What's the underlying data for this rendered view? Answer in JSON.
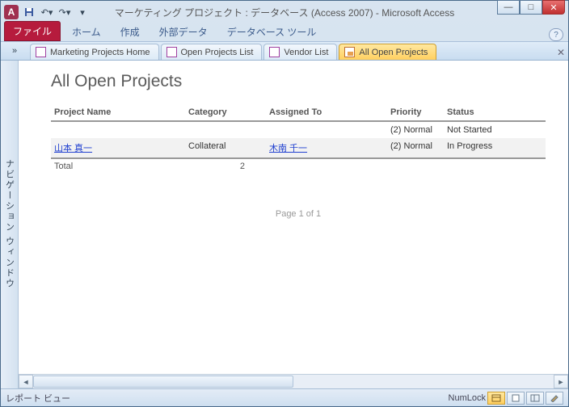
{
  "window": {
    "title": "マーケティング プロジェクト : データベース (Access 2007) - Microsoft Access",
    "app_letter": "A"
  },
  "ribbon": {
    "file": "ファイル",
    "home": "ホーム",
    "create": "作成",
    "external": "外部データ",
    "dbtools": "データベース ツール"
  },
  "tabs": [
    {
      "label": "Marketing Projects Home",
      "type": "form"
    },
    {
      "label": "Open Projects List",
      "type": "form"
    },
    {
      "label": "Vendor List",
      "type": "form"
    },
    {
      "label": "All Open Projects",
      "type": "report",
      "active": true
    }
  ],
  "nav_pane_label": "ナビゲーション ウィンドウ",
  "report": {
    "title": "All Open Projects",
    "columns": {
      "name": "Project Name",
      "category": "Category",
      "assigned": "Assigned To",
      "priority": "Priority",
      "status": "Status"
    },
    "rows": [
      {
        "name": "",
        "category": "",
        "assigned": "",
        "priority": "(2) Normal",
        "status": "Not Started"
      },
      {
        "name": "山本 真一",
        "name_link": true,
        "category": "Collateral",
        "assigned": "木南 千一",
        "assigned_link": true,
        "priority": "(2) Normal",
        "status": "In Progress"
      }
    ],
    "total_label": "Total",
    "total_value": "2",
    "page_info": "Page 1 of 1"
  },
  "statusbar": {
    "view_label": "レポート ビュー",
    "numlock": "NumLock"
  }
}
